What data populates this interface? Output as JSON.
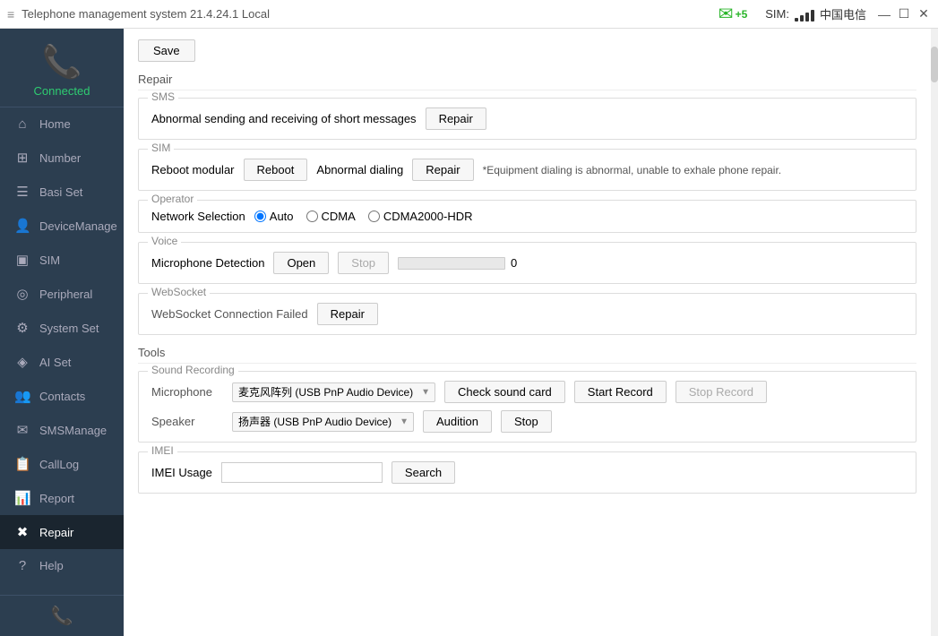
{
  "titleBar": {
    "menuIcon": "≡",
    "title": "Telephone management system  21.4.24.1  Local",
    "emailBadge": "+5",
    "sim": "SIM:",
    "carrier": "中国电信",
    "controls": [
      "—",
      "☐",
      "✕"
    ]
  },
  "sidebar": {
    "logoIcon": "📞",
    "connectedLabel": "Connected",
    "navItems": [
      {
        "id": "home",
        "icon": "⌂",
        "label": "Home",
        "active": false
      },
      {
        "id": "number",
        "icon": "⊞",
        "label": "Number",
        "active": false
      },
      {
        "id": "basi-set",
        "icon": "☰",
        "label": "Basi Set",
        "active": false
      },
      {
        "id": "device-manage",
        "icon": "👤",
        "label": "DeviceManage",
        "active": false
      },
      {
        "id": "sim",
        "icon": "▣",
        "label": "SIM",
        "active": false
      },
      {
        "id": "peripheral",
        "icon": "◎",
        "label": "Peripheral",
        "active": false
      },
      {
        "id": "system-set",
        "icon": "⚙",
        "label": "System Set",
        "active": false
      },
      {
        "id": "ai-set",
        "icon": "◈",
        "label": "AI Set",
        "active": false
      },
      {
        "id": "contacts",
        "icon": "👥",
        "label": "Contacts",
        "active": false
      },
      {
        "id": "sms-manage",
        "icon": "✉",
        "label": "SMSManage",
        "active": false
      },
      {
        "id": "call-log",
        "icon": "📋",
        "label": "CallLog",
        "active": false
      },
      {
        "id": "report",
        "icon": "📊",
        "label": "Report",
        "active": false
      },
      {
        "id": "repair",
        "icon": "✖",
        "label": "Repair",
        "active": true
      },
      {
        "id": "help",
        "icon": "?",
        "label": "Help",
        "active": false
      }
    ],
    "phoneIcon": "📞"
  },
  "content": {
    "saveButton": "Save",
    "sections": {
      "repair": {
        "label": "Repair",
        "sms": {
          "label": "SMS",
          "text": "Abnormal sending and receiving of short messages",
          "repairButton": "Repair"
        },
        "sim": {
          "label": "SIM",
          "rebootModularLabel": "Reboot modular",
          "rebootButton": "Reboot",
          "abnormalDialingLabel": "Abnormal dialing",
          "repairButton": "Repair",
          "warningText": "*Equipment dialing is abnormal, unable to exhale phone repair."
        },
        "operator": {
          "label": "Operator",
          "networkSelectionLabel": "Network Selection",
          "radioOptions": [
            "Auto",
            "CDMA",
            "CDMA2000-HDR"
          ],
          "selectedOption": "Auto"
        },
        "voice": {
          "label": "Voice",
          "micDetectionLabel": "Microphone Detection",
          "openButton": "Open",
          "stopButton": "Stop",
          "progressValue": "0"
        },
        "websocket": {
          "label": "WebSocket",
          "connectionFailedText": "WebSocket Connection Failed",
          "repairButton": "Repair"
        }
      },
      "tools": {
        "label": "Tools",
        "soundRecording": {
          "label": "Sound Recording",
          "microphoneLabel": "Microphone",
          "microphoneDevice": "麦克风阵列 (USB PnP Audio Device)",
          "checkSoundCardButton": "Check sound card",
          "startRecordButton": "Start Record",
          "stopRecordButton": "Stop Record",
          "speakerLabel": "Speaker",
          "speakerDevice": "扬声器 (USB PnP Audio Device)",
          "auditionButton": "Audition",
          "stopButton": "Stop"
        },
        "imei": {
          "label": "IMEI",
          "imeiUsageLabel": "IMEI Usage",
          "imeiInputValue": "",
          "imeiInputPlaceholder": "",
          "searchButton": "Search"
        }
      }
    }
  }
}
